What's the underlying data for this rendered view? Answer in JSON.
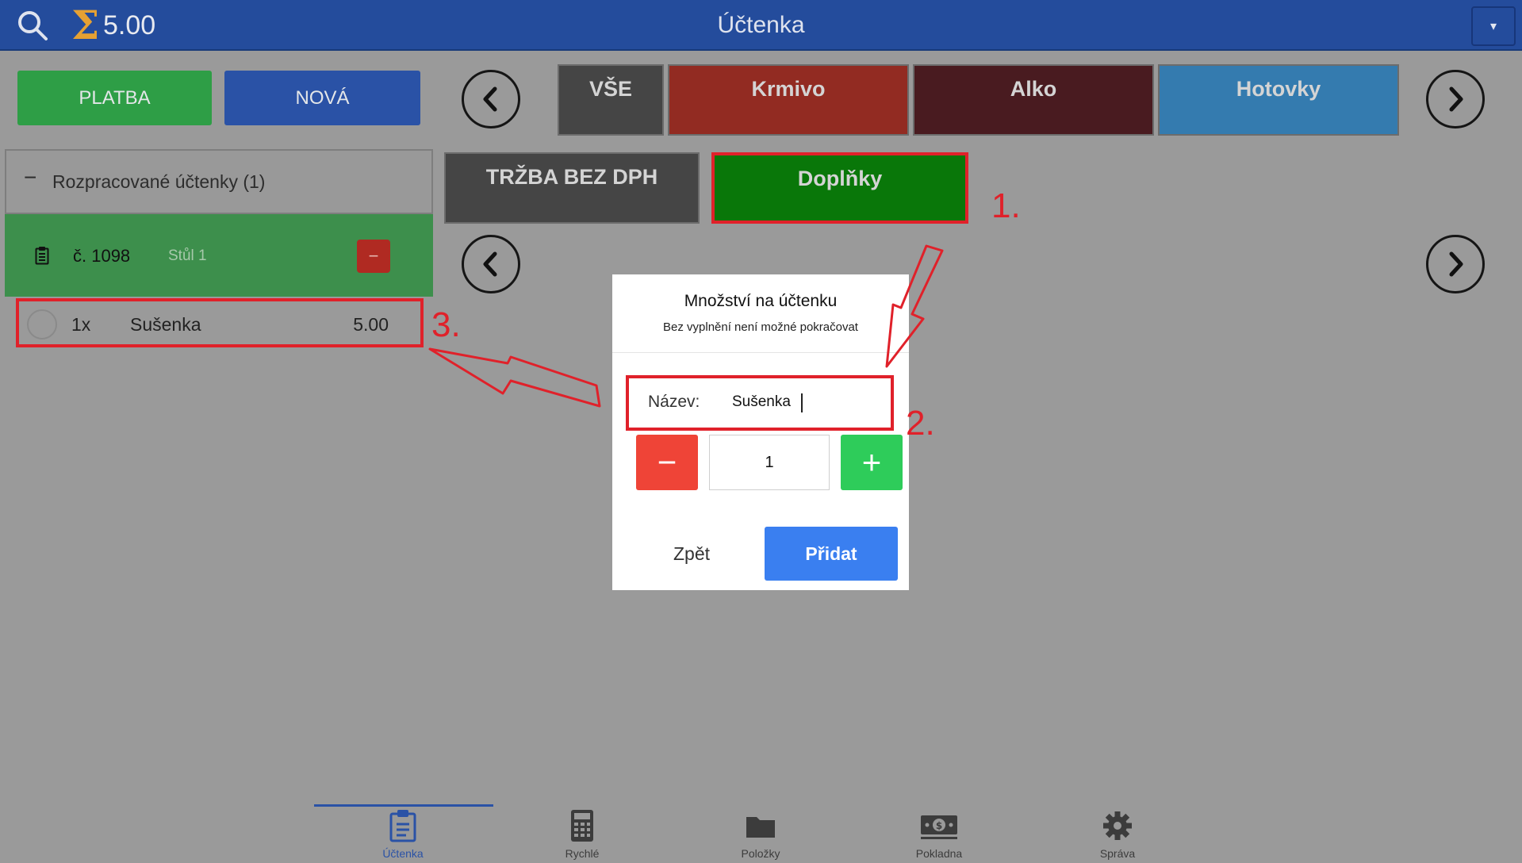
{
  "topbar": {
    "title": "Účtenka",
    "total_symbol": "Σ",
    "total": "5.00",
    "dropdown_glyph": "▾"
  },
  "actions": {
    "payment": "PLATBA",
    "new": "NOVÁ"
  },
  "categories": [
    "VŠE",
    "Krmivo",
    "Alko",
    "Hotovky"
  ],
  "subcategories": [
    "TRŽBA BEZ DPH",
    "Doplňky"
  ],
  "sidebar": {
    "group_toggle": "−",
    "group_title": "Rozpracované účtenky (1)",
    "receipt": {
      "number": "č. 1098",
      "table": "Stůl 1",
      "remove_glyph": "−"
    },
    "item": {
      "qty": "1x",
      "name": "Sušenka",
      "price": "5.00"
    }
  },
  "dialog": {
    "title": "Množství na účtenku",
    "subtitle": "Bez vyplnění není možné pokračovat",
    "name_label": "Název:",
    "name_value": "Sušenka",
    "minus": "−",
    "plus": "+",
    "quantity": "1",
    "back": "Zpět",
    "add": "Přidat"
  },
  "annotations": [
    "1.",
    "2.",
    "3."
  ],
  "bottom_nav": [
    {
      "label": "Účtenka",
      "icon": "receipt-icon",
      "active": true
    },
    {
      "label": "Rychlé",
      "icon": "calculator-icon",
      "active": false
    },
    {
      "label": "Položky",
      "icon": "folder-icon",
      "active": false
    },
    {
      "label": "Pokladna",
      "icon": "cash-icon",
      "active": false
    },
    {
      "label": "Správa",
      "icon": "gear-icon",
      "active": false
    }
  ],
  "colors": {
    "topbar": "#244c9c",
    "payment": "#2e9e46",
    "new": "#2a52a6",
    "highlight": "#e0212a",
    "add_button": "#3a7ff0",
    "active_nav": "#2a52a6"
  }
}
